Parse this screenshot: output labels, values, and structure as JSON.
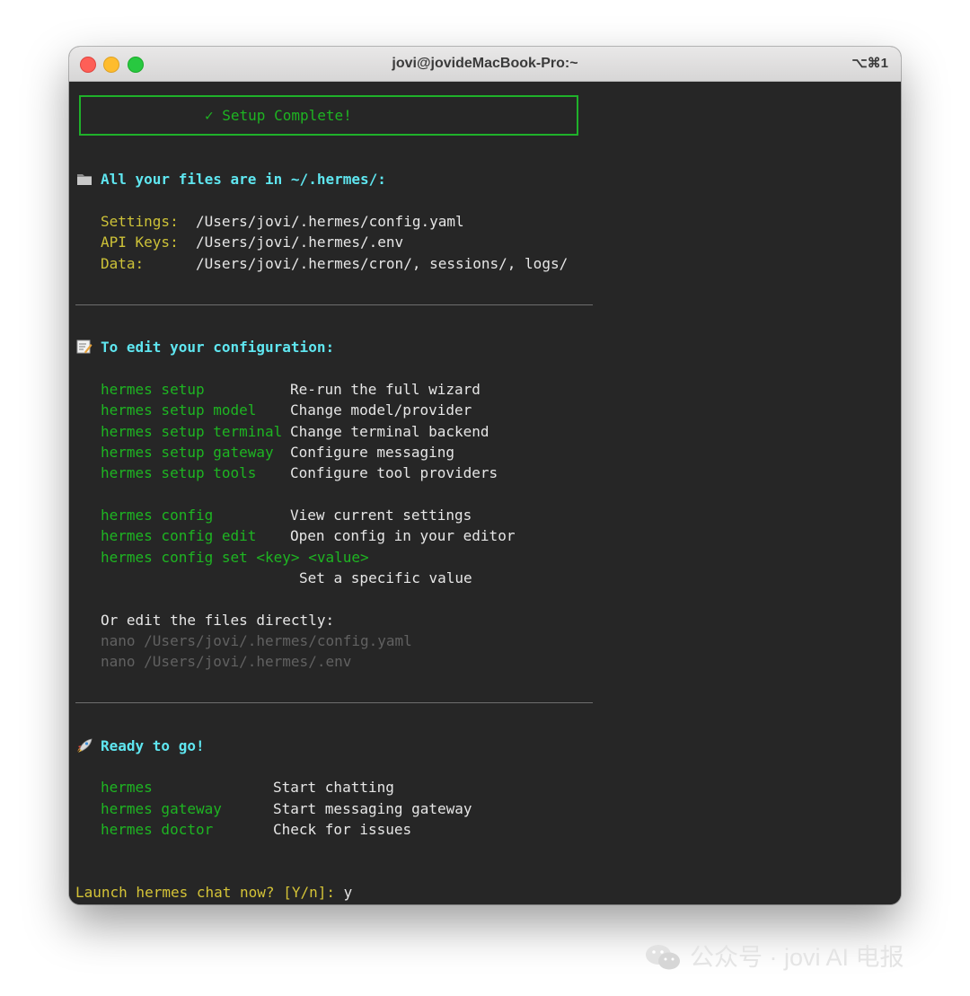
{
  "window": {
    "title": "jovi@jovideMacBook-Pro:~",
    "shortcut": "⌥⌘1"
  },
  "terminal": {
    "setup_complete": "✓ Setup Complete!",
    "files_heading": "All your files are in ~/.hermes/:",
    "files": [
      {
        "label": "Settings:",
        "path": "/Users/jovi/.hermes/config.yaml"
      },
      {
        "label": "API Keys:",
        "path": "/Users/jovi/.hermes/.env"
      },
      {
        "label": "Data:",
        "path": "/Users/jovi/.hermes/cron/, sessions/, logs/"
      }
    ],
    "config_heading": "To edit your configuration:",
    "setup_commands": [
      {
        "cmd": "hermes setup",
        "desc": "Re-run the full wizard"
      },
      {
        "cmd": "hermes setup model",
        "desc": "Change model/provider"
      },
      {
        "cmd": "hermes setup terminal",
        "desc": "Change terminal backend"
      },
      {
        "cmd": "hermes setup gateway",
        "desc": "Configure messaging"
      },
      {
        "cmd": "hermes setup tools",
        "desc": "Configure tool providers"
      }
    ],
    "config_commands": [
      {
        "cmd": "hermes config",
        "desc": "View current settings"
      },
      {
        "cmd": "hermes config edit",
        "desc": "Open config in your editor"
      }
    ],
    "config_set_cmd": "hermes config set <key> <value>",
    "config_set_desc": "Set a specific value",
    "edit_directly": "Or edit the files directly:",
    "nano_lines": [
      "nano /Users/jovi/.hermes/config.yaml",
      "nano /Users/jovi/.hermes/.env"
    ],
    "ready_heading": "Ready to go!",
    "ready_commands": [
      {
        "cmd": "hermes",
        "desc": "Start chatting"
      },
      {
        "cmd": "hermes gateway",
        "desc": "Start messaging gateway"
      },
      {
        "cmd": "hermes doctor",
        "desc": "Check for issues"
      }
    ],
    "prompt": "Launch hermes chat now? [Y/n]: ",
    "prompt_answer": "y"
  },
  "watermark": {
    "text": "公众号 · jovi AI 电报",
    "icon": "wechat-icon"
  },
  "colors": {
    "terminal_bg": "#262626",
    "green": "#1eb522",
    "cyan": "#5fe6f0",
    "yellow": "#cdc238",
    "grey": "#616161"
  }
}
